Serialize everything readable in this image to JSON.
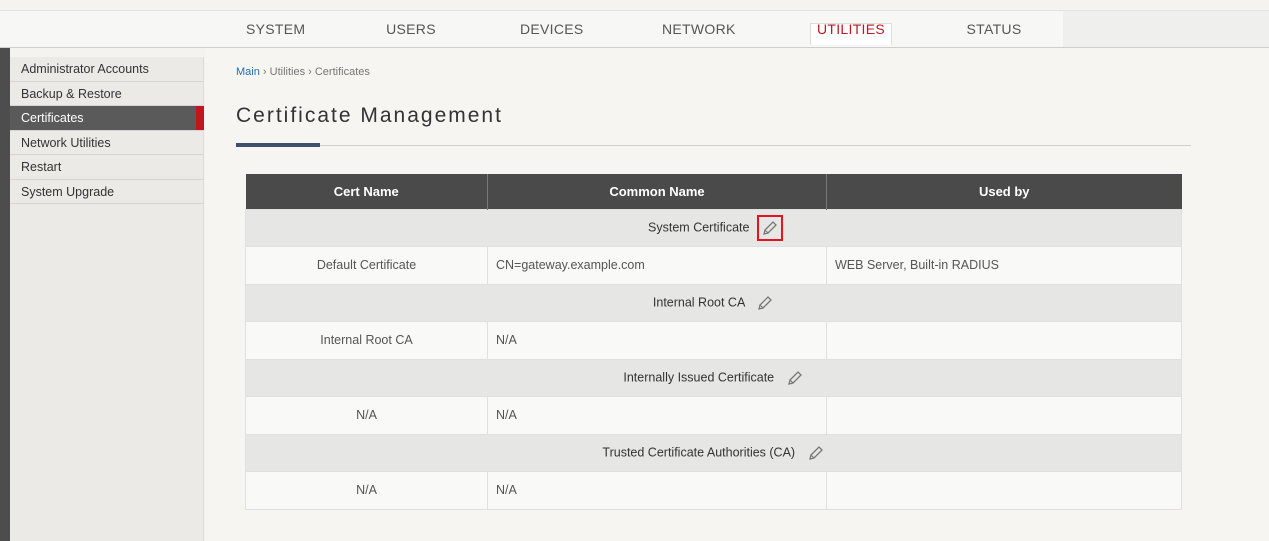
{
  "nav": {
    "items": [
      {
        "label": "SYSTEM"
      },
      {
        "label": "USERS"
      },
      {
        "label": "DEVICES"
      },
      {
        "label": "NETWORK"
      },
      {
        "label": "UTILITIES",
        "active": true
      },
      {
        "label": "STATUS"
      }
    ],
    "active_color": "#c0161f"
  },
  "sidebar": {
    "items": [
      {
        "label": "Administrator Accounts"
      },
      {
        "label": "Backup & Restore"
      },
      {
        "label": "Certificates",
        "active": true
      },
      {
        "label": "Network Utilities"
      },
      {
        "label": "Restart"
      },
      {
        "label": "System Upgrade"
      }
    ]
  },
  "breadcrumb": {
    "main": "Main",
    "sep": " › ",
    "utilities": "Utilities",
    "certificates": "Certificates"
  },
  "page": {
    "title": "Certificate Management"
  },
  "table": {
    "headers": [
      "Cert Name",
      "Common Name",
      "Used by"
    ],
    "sections": [
      {
        "title": "System Certificate",
        "icon": "pencil-icon",
        "highlighted": true,
        "row": [
          "Default Certificate",
          "CN=gateway.example.com",
          "WEB Server, Built-in RADIUS"
        ]
      },
      {
        "title": "Internal Root CA",
        "icon": "pencil-icon",
        "row": [
          "Internal Root CA",
          "N/A",
          ""
        ]
      },
      {
        "title": "Internally Issued Certificate",
        "icon": "pencil-icon",
        "row": [
          "N/A",
          "N/A",
          ""
        ]
      },
      {
        "title": "Trusted Certificate Authorities (CA)",
        "icon": "pencil-icon",
        "row": [
          "N/A",
          "N/A",
          ""
        ]
      }
    ]
  }
}
